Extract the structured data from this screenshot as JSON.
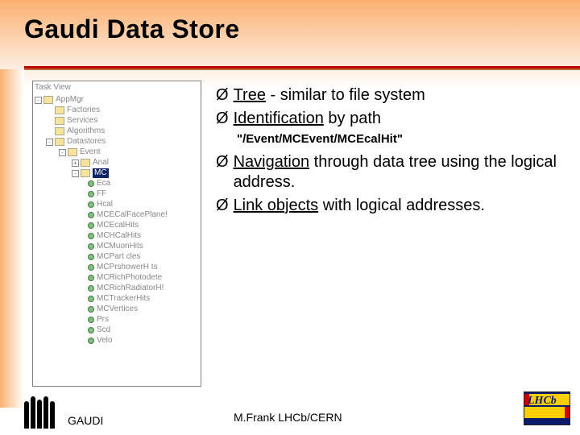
{
  "title": "Gaudi Data Store",
  "tree": {
    "header": "Task View",
    "root": "AppMgr",
    "level1": [
      "Factories",
      "Services",
      "Algorithms",
      "Datastores"
    ],
    "ds_child": "Event",
    "ev_children_pre": [
      "Anal"
    ],
    "selected": "MC",
    "mc_children": [
      "Eca",
      "FF",
      "Hcal",
      "MCECalFacePlane!",
      "MCEcalHits",
      "MCHCalHits",
      "MCMuonHits",
      "MCPart cles",
      "MCPrshowerH ts",
      "MCRichPhotodete",
      "MCRichRadiatorH!",
      "MCTrackerHits",
      "MCVertices",
      "Prs",
      "Scd",
      "Velo"
    ]
  },
  "bullets": {
    "b1_key": "Tree",
    "b1_rest": " - similar to file system",
    "b2_key": "Identification",
    "b2_rest": " by path",
    "b2_sub": "\"/Event/MCEvent/MCEcalHit\"",
    "b3_key": "Navigation",
    "b3_rest": " through data tree using the logical address.",
    "b4_key": "Link objects",
    "b4_rest": " with logical addresses."
  },
  "footer": {
    "left": "GAUDI",
    "center": "M.Frank LHCb/CERN",
    "logo_top": "LHCb"
  }
}
